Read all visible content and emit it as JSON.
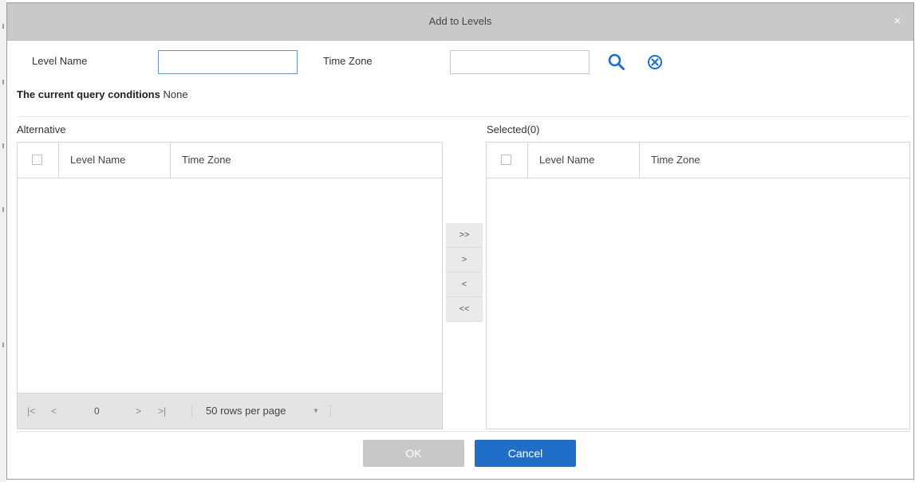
{
  "dialog": {
    "title": "Add to Levels",
    "close_symbol": "×"
  },
  "query": {
    "level_name_label": "Level Name",
    "level_name_value": "",
    "time_zone_label": "Time Zone",
    "time_zone_value": "",
    "search_icon": "search-icon",
    "clear_icon": "clear-circle-icon",
    "conditions_label": "The current query conditions",
    "conditions_value": "None"
  },
  "alternative": {
    "title": "Alternative",
    "columns": [
      "Level Name",
      "Time Zone"
    ],
    "rows": [],
    "pager": {
      "first": "|<",
      "prev": "<",
      "page": "0",
      "next": ">",
      "last": ">|",
      "rows_per_page": "50 rows per page",
      "dropdown_symbol": "▼"
    }
  },
  "selected": {
    "title": "Selected(0)",
    "columns": [
      "Level Name",
      "Time Zone"
    ],
    "rows": []
  },
  "transfer": {
    "all_right": ">>",
    "right": ">",
    "left": "<",
    "all_left": "<<"
  },
  "footer": {
    "ok_label": "OK",
    "cancel_label": "Cancel"
  },
  "colors": {
    "titlebar": "#c9c9c9",
    "primary_button": "#1f6fc8",
    "disabled_button": "#c8c8c8",
    "icon_blue": "#1f6fc8"
  }
}
